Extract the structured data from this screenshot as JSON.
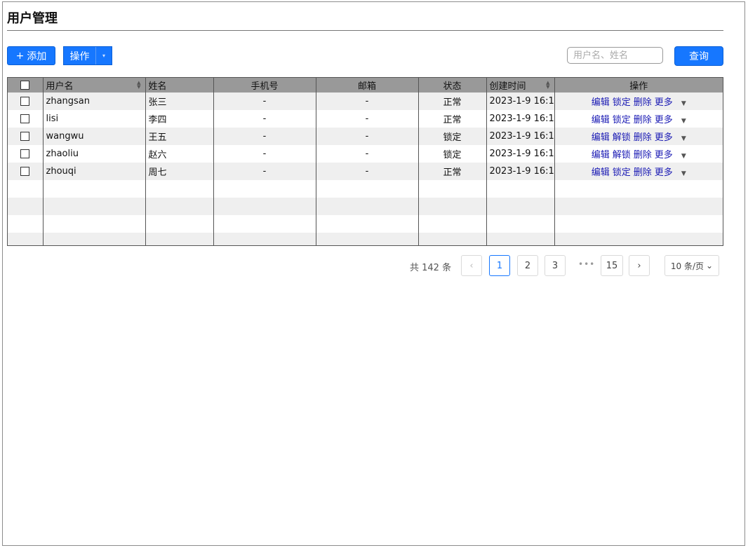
{
  "page": {
    "title": "用户管理"
  },
  "toolbar": {
    "add_plus": "+",
    "add_label": "添加",
    "ops_label": "操作",
    "ops_caret": "▾",
    "search_placeholder": "用户名、姓名",
    "query_label": "查询"
  },
  "table": {
    "headers": [
      "用户名",
      "姓名",
      "手机号",
      "邮箱",
      "状态",
      "创建时间",
      "操作"
    ],
    "rows": [
      {
        "username": "zhangsan",
        "name": "张三",
        "phone": "-",
        "email": "-",
        "status": "正常",
        "created": "2023-1-9 16:1",
        "actions": [
          "编辑",
          "锁定",
          "删除",
          "更多"
        ]
      },
      {
        "username": "lisi",
        "name": "李四",
        "phone": "-",
        "email": "-",
        "status": "正常",
        "created": "2023-1-9 16:1",
        "actions": [
          "编辑",
          "锁定",
          "删除",
          "更多"
        ]
      },
      {
        "username": "wangwu",
        "name": "王五",
        "phone": "-",
        "email": "-",
        "status": "锁定",
        "created": "2023-1-9 16:1",
        "actions": [
          "编辑",
          "解锁",
          "删除",
          "更多"
        ]
      },
      {
        "username": "zhaoliu",
        "name": "赵六",
        "phone": "-",
        "email": "-",
        "status": "锁定",
        "created": "2023-1-9 16:1",
        "actions": [
          "编辑",
          "解锁",
          "删除",
          "更多"
        ]
      },
      {
        "username": "zhouqi",
        "name": "周七",
        "phone": "-",
        "email": "-",
        "status": "正常",
        "created": "2023-1-9 16:1",
        "actions": [
          "编辑",
          "锁定",
          "删除",
          "更多"
        ]
      }
    ],
    "more_caret": "▼",
    "sort_icon_up": "▲",
    "sort_icon_down": "▼"
  },
  "pagination": {
    "total": "共 142 条",
    "prev": "‹",
    "pages": [
      "1",
      "2",
      "3",
      "15"
    ],
    "ellipsis": "•••",
    "next": "›",
    "page_size": "10 条/页",
    "page_size_caret": "⌄"
  }
}
